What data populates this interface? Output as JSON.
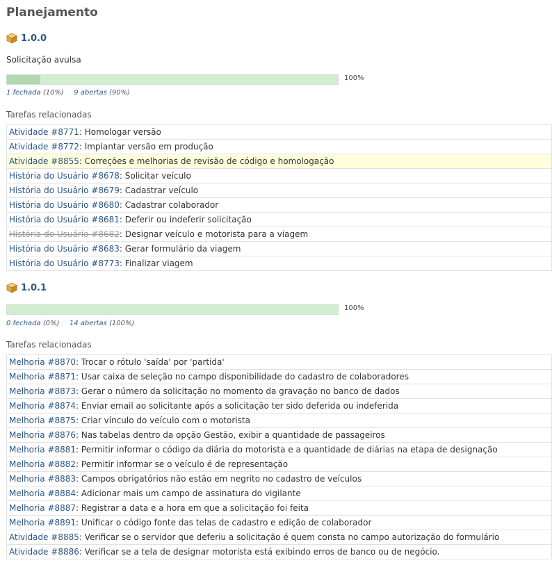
{
  "page_title": "Planejamento",
  "colors": {
    "link": "#2a5685",
    "progress_closed": "#b1d8b1",
    "progress_open": "#d3edd3",
    "highlight_row": "#ffffdd"
  },
  "versions": [
    {
      "icon": "package-icon",
      "name": "1.0.0",
      "description": "Solicitação avulsa",
      "progress_closed_fraction": 0.1,
      "progress_percent_label": "100%",
      "closed_label": "1 fechada",
      "closed_pct": "(10%)",
      "open_label": "9 abertas",
      "open_pct": "(90%)",
      "related_label": "Tarefas relacionadas",
      "issues": [
        {
          "link": "Atividade #8771",
          "subject": "Homologar versão"
        },
        {
          "link": "Atividade #8772",
          "subject": "Implantar versão em produção"
        },
        {
          "link": "Atividade #8855",
          "subject": "Correções e melhorias de revisão de código e homologação"
        },
        {
          "link": "História do Usuário #8678",
          "subject": "Solicitar veículo"
        },
        {
          "link": "História do Usuário #8679",
          "subject": "Cadastrar veículo"
        },
        {
          "link": "História do Usuário #8680",
          "subject": "Cadastrar colaborador"
        },
        {
          "link": "História do Usuário #8681",
          "subject": "Deferir ou indeferir solicitação"
        },
        {
          "link": "História do Usuário #8682",
          "subject": "Designar veículo e motorista para a viagem"
        },
        {
          "link": "História do Usuário #8683",
          "subject": "Gerar formulário da viagem"
        },
        {
          "link": "História do Usuário #8773",
          "subject": "Finalizar viagem"
        }
      ]
    },
    {
      "icon": "package-icon",
      "name": "1.0.1",
      "description": "",
      "progress_closed_fraction": 0.0,
      "progress_percent_label": "100%",
      "closed_label": "0 fechada",
      "closed_pct": "(0%)",
      "open_label": "14 abertas",
      "open_pct": "(100%)",
      "related_label": "Tarefas relacionadas",
      "issues": [
        {
          "link": "Melhoria #8870",
          "subject": "Trocar o rótulo 'saída' por 'partida'"
        },
        {
          "link": "Melhoria #8871",
          "subject": "Usar caixa de seleção no campo disponibilidade do cadastro de colaboradores"
        },
        {
          "link": "Melhoria #8873",
          "subject": "Gerar o número da solicitação no momento da gravação no banco de dados"
        },
        {
          "link": "Melhoria #8874",
          "subject": "Enviar email ao solicitante após a solicitação ter sido deferida ou indeferida"
        },
        {
          "link": "Melhoria #8875",
          "subject": "Criar vínculo do veículo com o motorista"
        },
        {
          "link": "Melhoria #8876",
          "subject": "Nas tabelas dentro da opção Gestão, exibir a quantidade de passageiros"
        },
        {
          "link": "Melhoria #8881",
          "subject": "Permitir informar o código da diária do motorista e a quantidade de diárias na etapa de designação"
        },
        {
          "link": "Melhoria #8882",
          "subject": "Permitir informar se o veículo é de representação"
        },
        {
          "link": "Melhoria #8883",
          "subject": "Campos obrigatórios não estão em negrito no cadastro de veículos"
        },
        {
          "link": "Melhoria #8884",
          "subject": "Adicionar mais um campo de assinatura do vigilante"
        },
        {
          "link": "Melhoria #8887",
          "subject": "Registrar a data e a hora em que a solicitação foi feita"
        },
        {
          "link": "Melhoria #8891",
          "subject": "Unificar o código fonte das telas de cadastro e edição de colaborador"
        },
        {
          "link": "Atividade #8885",
          "subject": "Verificar se o servidor que deferiu a solicitação é quem consta no campo autorização do formulário"
        },
        {
          "link": "Atividade #8886",
          "subject": "Verificar se a tela de designar motorista está exibindo erros de banco ou de negócio."
        }
      ]
    }
  ]
}
